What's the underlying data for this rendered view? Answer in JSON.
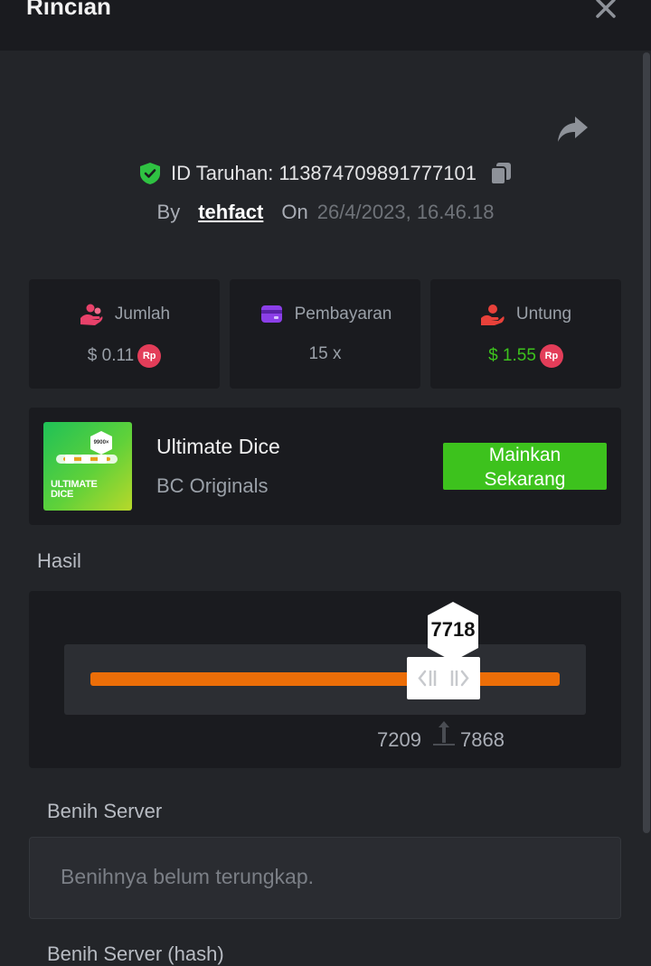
{
  "header": {
    "title": "Rincian"
  },
  "bet": {
    "id_label": "ID Taruhan:",
    "id_value": "113874709891777101",
    "by_label": "By",
    "user": "tehfact",
    "on_label": "On",
    "date": "26/4/2023, 16.46.18"
  },
  "stats": [
    {
      "label": "Jumlah",
      "value": "$ 0.11",
      "currency_badge": "Rp",
      "icon": "coins-icon"
    },
    {
      "label": "Pembayaran",
      "value": "15 x",
      "icon": "wallet-icon"
    },
    {
      "label": "Untung",
      "value": "$ 1.55",
      "currency_badge": "Rp",
      "icon": "hand-coin-icon"
    }
  ],
  "game": {
    "name": "Ultimate Dice",
    "provider": "BC Originals",
    "thumb_logo_line1": "ULTIMATE",
    "thumb_logo_line2": "DICE",
    "thumb_badge": "9900×",
    "play_line1": "Mainkan",
    "play_line2": "Sekarang"
  },
  "result": {
    "label": "Hasil",
    "value": "7718",
    "range_low": "7209",
    "range_high": "7868"
  },
  "seed": {
    "server_label": "Benih Server",
    "server_value": "Benihnya belum terungkap.",
    "server_hash_label": "Benih Server (hash)"
  },
  "colors": {
    "accent_green": "#3dc21d",
    "profit_green": "#3dc21d",
    "bar_orange": "#ec6e08",
    "badge_red": "#e33d59"
  }
}
